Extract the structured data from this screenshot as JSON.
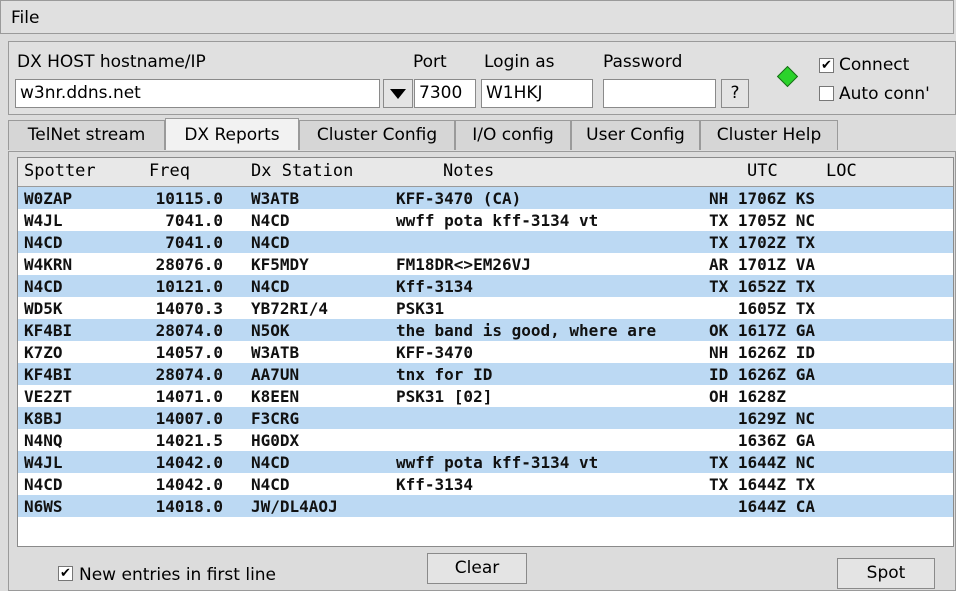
{
  "menubar": {
    "file_label": "File"
  },
  "host": {
    "hostname_label": "DX HOST hostname/IP",
    "hostname_value": "w3nr.ddns.net",
    "port_label": "Port",
    "port_value": "7300",
    "login_label": "Login as",
    "login_value": "W1HKJ",
    "password_label": "Password",
    "password_value": "",
    "help_label": "?",
    "connect_label": "Connect",
    "connect_checked": true,
    "autoconn_label": "Auto conn'",
    "autoconn_checked": false,
    "status_color": "#2bd32b"
  },
  "tabs": [
    {
      "label": "TelNet stream"
    },
    {
      "label": "DX Reports"
    },
    {
      "label": "Cluster Config"
    },
    {
      "label": "I/O config"
    },
    {
      "label": "User Config"
    },
    {
      "label": "Cluster Help"
    }
  ],
  "active_tab": "DX Reports",
  "table": {
    "headers": [
      "Spotter",
      "Freq",
      "Dx Station",
      "Notes",
      "UTC",
      "LOC"
    ],
    "rows": [
      {
        "spotter": "W0ZAP",
        "freq": "10115.0",
        "dx": "W3ATB",
        "notes": "KFF-3470 (CA)",
        "utc": "NH 1706Z KS"
      },
      {
        "spotter": "W4JL",
        "freq": "7041.0",
        "dx": "N4CD",
        "notes": "wwff pota kff-3134 vt",
        "utc": "TX 1705Z NC"
      },
      {
        "spotter": "N4CD",
        "freq": "7041.0",
        "dx": "N4CD",
        "notes": "",
        "utc": "TX 1702Z TX"
      },
      {
        "spotter": "W4KRN",
        "freq": "28076.0",
        "dx": "KF5MDY",
        "notes": "FM18DR<>EM26VJ",
        "utc": "AR 1701Z VA"
      },
      {
        "spotter": "N4CD",
        "freq": "10121.0",
        "dx": "N4CD",
        "notes": "Kff-3134",
        "utc": "TX 1652Z TX"
      },
      {
        "spotter": "WD5K",
        "freq": "14070.3",
        "dx": "YB72RI/4",
        "notes": "PSK31",
        "utc": "   1605Z TX"
      },
      {
        "spotter": "KF4BI",
        "freq": "28074.0",
        "dx": "N5OK",
        "notes": "the band is good, where are",
        "utc": "OK 1617Z GA"
      },
      {
        "spotter": "K7ZO",
        "freq": "14057.0",
        "dx": "W3ATB",
        "notes": "KFF-3470",
        "utc": "NH 1626Z ID"
      },
      {
        "spotter": "KF4BI",
        "freq": "28074.0",
        "dx": "AA7UN",
        "notes": "tnx for ID",
        "utc": "ID 1626Z GA"
      },
      {
        "spotter": "VE2ZT",
        "freq": "14071.0",
        "dx": "K8EEN",
        "notes": "PSK31 [02]",
        "utc": "OH 1628Z"
      },
      {
        "spotter": "K8BJ",
        "freq": "14007.0",
        "dx": "F3CRG",
        "notes": "",
        "utc": "   1629Z NC"
      },
      {
        "spotter": "N4NQ",
        "freq": "14021.5",
        "dx": "HG0DX",
        "notes": "",
        "utc": "   1636Z GA"
      },
      {
        "spotter": "W4JL",
        "freq": "14042.0",
        "dx": "N4CD",
        "notes": "wwff pota kff-3134 vt",
        "utc": "TX 1644Z NC"
      },
      {
        "spotter": "N4CD",
        "freq": "14042.0",
        "dx": "N4CD",
        "notes": "Kff-3134",
        "utc": "TX 1644Z TX"
      },
      {
        "spotter": "N6WS",
        "freq": "14018.0",
        "dx": "JW/DL4AOJ",
        "notes": "",
        "utc": "   1644Z CA"
      }
    ]
  },
  "bottom": {
    "new_entries_label": "New entries in first line",
    "new_entries_checked": true,
    "clear_label": "Clear",
    "spot_label": "Spot"
  }
}
